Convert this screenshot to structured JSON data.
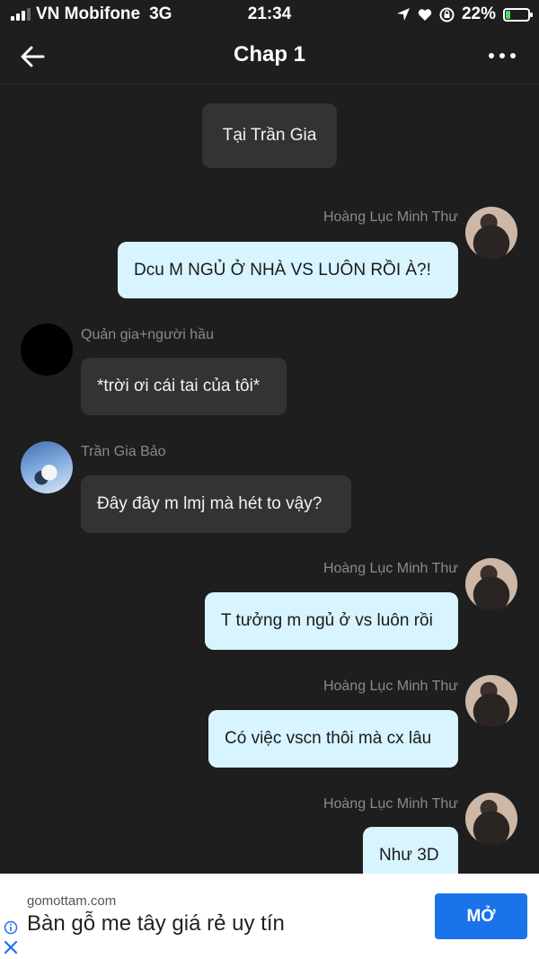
{
  "status_bar": {
    "carrier": "VN Mobifone",
    "network": "3G",
    "time": "21:34",
    "battery_percent": "22%",
    "battery_level": 0.22
  },
  "header": {
    "title": "Chap 1"
  },
  "messages": [
    {
      "type": "narration",
      "text": "Tại Trần Gia"
    },
    {
      "type": "me",
      "sender": "Hoàng Lục Minh Thư",
      "text": "Dcu M NGỦ Ở NHÀ VS LUÔN RỒI À?!"
    },
    {
      "type": "other",
      "sender": "Quản gia+người hầu",
      "text": "*trời ơi cái tai của tôi*"
    },
    {
      "type": "other",
      "sender": "Trần Gia Bảo",
      "text": "Đây đây m lmj mà hét to vậy?"
    },
    {
      "type": "me",
      "sender": "Hoàng Lục Minh Thư",
      "text": "T tưởng m ngủ ở vs luôn rồi"
    },
    {
      "type": "me",
      "sender": "Hoàng Lục Minh Thư",
      "text": "Có việc vscn thôi mà cx lâu"
    },
    {
      "type": "me",
      "sender": "Hoàng Lục Minh Thư",
      "text": "Như 3D"
    }
  ],
  "ad": {
    "domain": "gomottam.com",
    "headline": "Bàn gỗ me tây giá rẻ uy tín",
    "cta": "MỞ",
    "cta_color": "#1a73e8"
  },
  "colors": {
    "background": "#1e1e1e",
    "bubble_other": "#333333",
    "bubble_me": "#d8f5ff"
  }
}
